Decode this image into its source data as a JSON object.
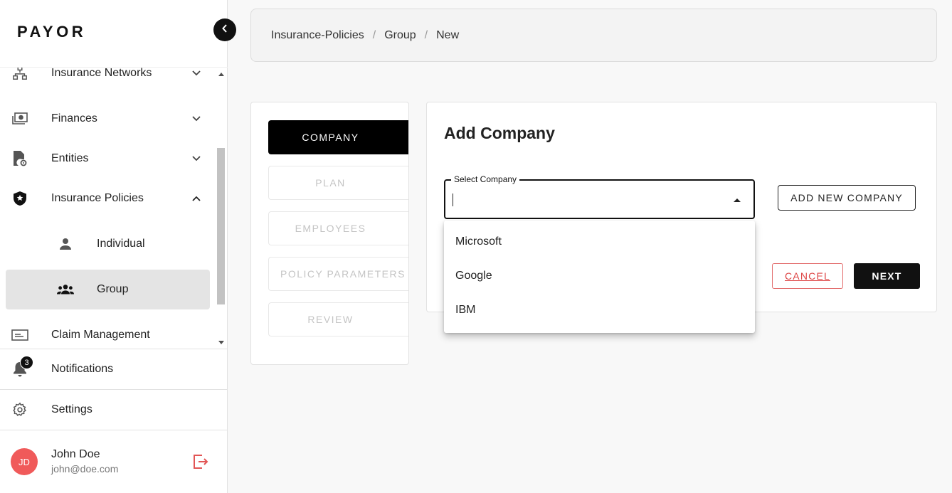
{
  "app": {
    "logo": "PAYOR"
  },
  "sidebar": {
    "items": [
      {
        "label": "Insurance Networks",
        "icon": "network-icon",
        "expandable": true,
        "expanded": false
      },
      {
        "label": "Finances",
        "icon": "money-icon",
        "expandable": true,
        "expanded": false
      },
      {
        "label": "Entities",
        "icon": "file-settings-icon",
        "expandable": true,
        "expanded": false
      },
      {
        "label": "Insurance Policies",
        "icon": "shield-icon",
        "expandable": true,
        "expanded": true
      },
      {
        "label": "Individual",
        "icon": "person-icon",
        "sub": true
      },
      {
        "label": "Group",
        "icon": "group-icon",
        "sub": true,
        "active": true
      },
      {
        "label": "Claim Management",
        "icon": "card-icon"
      }
    ],
    "bottom": {
      "notifications": {
        "label": "Notifications",
        "badge": "3"
      },
      "settings": {
        "label": "Settings"
      }
    },
    "user": {
      "initials": "JD",
      "name": "John Doe",
      "email": "john@doe.com"
    }
  },
  "breadcrumb": [
    "Insurance-Policies",
    "Group",
    "New"
  ],
  "stepper": {
    "steps": [
      "COMPANY",
      "PLAN",
      "EMPLOYEES",
      "POLICY PARAMETERS",
      "REVIEW"
    ],
    "active_index": 0
  },
  "form": {
    "title": "Add Company",
    "select_label": "Select Company",
    "select_value": "",
    "add_new_label": "ADD NEW COMPANY",
    "cancel_label": "CANCEL",
    "next_label": "NEXT"
  },
  "dropdown": {
    "options": [
      "Microsoft",
      "Google",
      "IBM"
    ]
  },
  "colors": {
    "accent": "#111111",
    "danger": "#e26a6a",
    "avatar": "#f05a5a",
    "active_nav": "#e4e4e4"
  }
}
